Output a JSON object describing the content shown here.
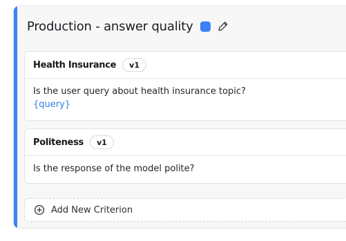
{
  "section": {
    "title": "Production - answer quality",
    "accent_color": "#3b82f6",
    "status_color": "#3b82f6"
  },
  "criteria": [
    {
      "name": "Health Insurance",
      "version": "v1",
      "prompt": "Is the user query about health insurance topic?",
      "variable": "{query}"
    },
    {
      "name": "Politeness",
      "version": "v1",
      "prompt": "Is the response of the model polite?"
    }
  ],
  "add_criterion_label": "Add New Criterion",
  "icons": {
    "edit": "pencil-icon",
    "add": "plus-circle-icon"
  }
}
